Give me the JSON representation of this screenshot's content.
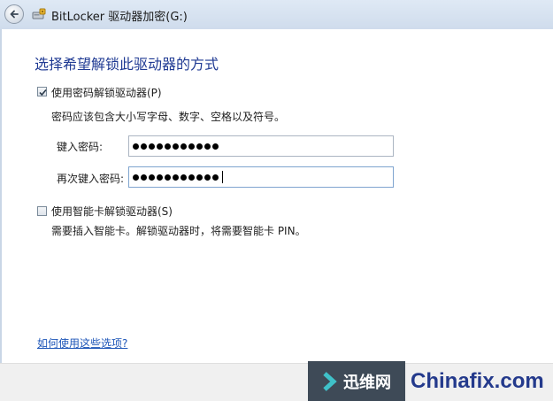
{
  "window": {
    "title": "BitLocker 驱动器加密(G:)"
  },
  "page": {
    "heading": "选择希望解锁此驱动器的方式"
  },
  "password_option": {
    "checked": true,
    "label": "使用密码解锁驱动器(P)",
    "hint": "密码应该包含大小写字母、数字、空格以及符号。",
    "enter_label": "键入密码:",
    "reenter_label": "再次键入密码:",
    "password_length": 11,
    "reenter_length": 11
  },
  "smartcard_option": {
    "checked": false,
    "label": "使用智能卡解锁驱动器(S)",
    "hint": "需要插入智能卡。解锁驱动器时，将需要智能卡 PIN。"
  },
  "help_link": "如何使用这些选项?",
  "watermark": {
    "brand": "迅维网",
    "site": "Chinafix.com"
  },
  "colors": {
    "heading": "#1f3a93",
    "link": "#1e56b8",
    "titlebar": "#d6e2f0"
  },
  "icons": {
    "back": "back-arrow-icon",
    "app": "bitlocker-drive-icon",
    "check": "checkmark-icon"
  }
}
